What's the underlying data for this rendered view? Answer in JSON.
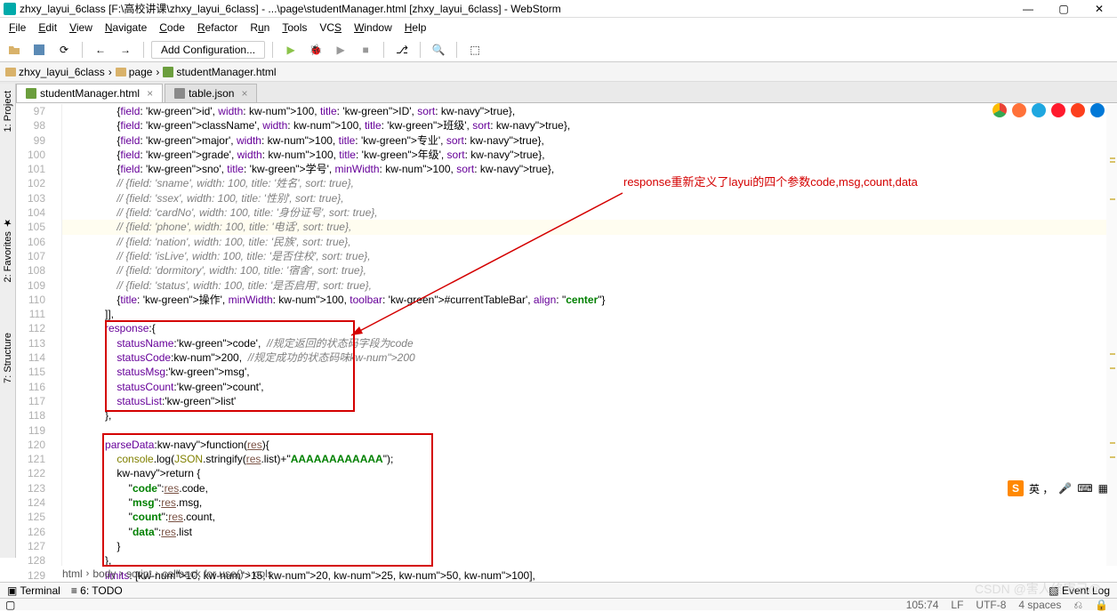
{
  "window": {
    "title": "zhxy_layui_6class [F:\\高校讲课\\zhxy_layui_6class] - ...\\page\\studentManager.html [zhxy_layui_6class] - WebStorm"
  },
  "menu": {
    "items": [
      "File",
      "Edit",
      "View",
      "Navigate",
      "Code",
      "Refactor",
      "Run",
      "Tools",
      "VCS",
      "Window",
      "Help"
    ]
  },
  "toolbar": {
    "add_config": "Add Configuration..."
  },
  "nav": {
    "project": "zhxy_layui_6class",
    "folder": "page",
    "file": "studentManager.html"
  },
  "tabs": {
    "t1": "studentManager.html",
    "t2": "table.json"
  },
  "gutter": {
    "start": 97,
    "end": 129
  },
  "annotation": "response重新定义了layui的四个参数code,msg,count,data",
  "code": [
    "{field: 'id', width: 100, title: 'ID', sort: true},",
    "{field: 'className', width: 100, title: '班级', sort: true},",
    "{field: 'major', width: 100, title: '专业', sort: true},",
    "{field: 'grade', width: 100, title: '年级', sort: true},",
    "{field: 'sno', title: '学号', minWidth: 100, sort: true},",
    "// {field: 'sname', width: 100, title: '姓名', sort: true},",
    "// {field: 'ssex', width: 100, title: '性别', sort: true},",
    "// {field: 'cardNo', width: 100, title: '身份证号', sort: true},",
    "// {field: 'phone', width: 100, title: '电话', sort: true},",
    "// {field: 'nation', width: 100, title: '民族', sort: true},",
    "// {field: 'isLive', width: 100, title: '是否住校', sort: true},",
    "// {field: 'dormitory', width: 100, title: '宿舍', sort: true},",
    "// {field: 'status', width: 100, title: '是否启用', sort: true},",
    "{title: '操作', minWidth: 100, toolbar: '#currentTableBar', align: \"center\"}",
    "]],",
    "response:{",
    "    statusName:'code',  //规定返回的状态码字段为code",
    "    statusCode:200,  //规定成功的状态码味200",
    "    statusMsg:'msg',",
    "    statusCount:'count',",
    "    statusList:'list'",
    "},",
    "",
    "parseData:function(res){",
    "    console.log(JSON.stringify(res.list)+\"AAAAAAAAAAAA\");",
    "    return {",
    "        \"code\":res.code,",
    "        \"msg\":res.msg,",
    "        \"count\":res.count,",
    "        \"data\":res.list",
    "    }",
    "},",
    "limits: [10, 15, 20, 25, 50, 100],"
  ],
  "breadcrumb": {
    "p1": "html",
    "p2": "body",
    "p3": "script",
    "p4": "callback for use()",
    "p5": "cols"
  },
  "status": {
    "terminal": "Terminal",
    "todo": "6: TODO",
    "eventlog": "Event Log",
    "pos": "105:74",
    "lf": "LF",
    "enc": "UTF-8",
    "spaces": "4 spaces",
    "git": "Git"
  },
  "watermark": "CSDN @害人终害己@"
}
